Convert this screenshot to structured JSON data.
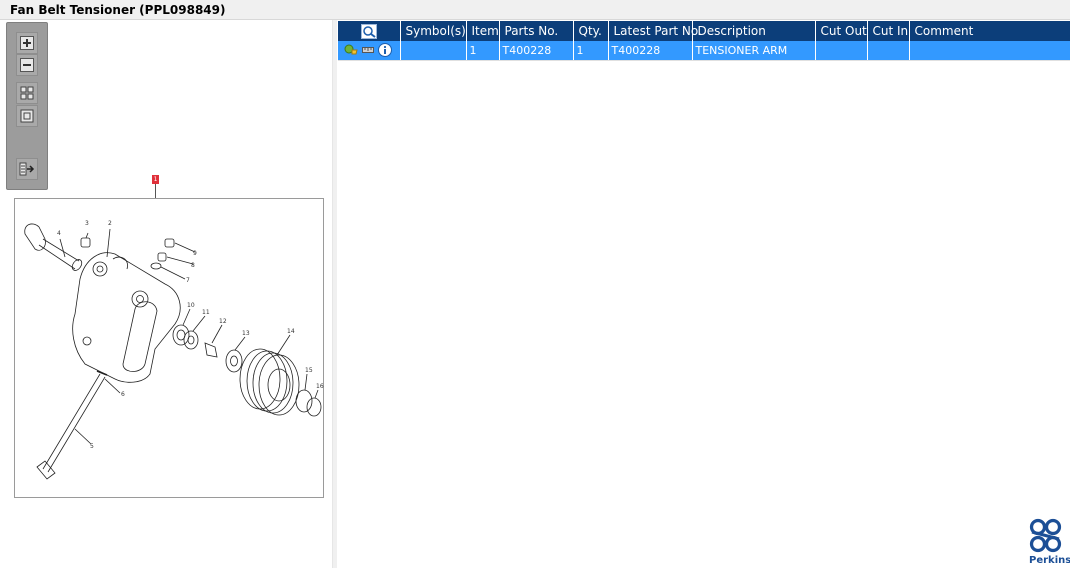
{
  "window": {
    "title": "Fan Belt Tensioner (PPL098849)"
  },
  "toolbar": {
    "buttons": [
      {
        "name": "zoom-in",
        "icon": "plus-icon"
      },
      {
        "name": "zoom-out",
        "icon": "minus-icon"
      },
      {
        "name": "fit-all",
        "icon": "grid-icon"
      },
      {
        "name": "actual-size",
        "icon": "square-icon"
      },
      {
        "name": "export",
        "icon": "list-arrow-icon"
      }
    ]
  },
  "drawing": {
    "callout_label": "1",
    "part_labels": [
      "2",
      "3",
      "4",
      "5",
      "6",
      "7",
      "8",
      "9",
      "10",
      "11",
      "12",
      "13",
      "14",
      "15",
      "16"
    ]
  },
  "table": {
    "header_icon": "search-parts-icon",
    "columns": [
      "Symbol(s)",
      "Item",
      "Parts No.",
      "Qty.",
      "Latest Part No.",
      "Description",
      "Cut Out",
      "Cut In",
      "Comment"
    ],
    "rows": [
      {
        "icons": [
          "add-to-cart-icon",
          "ruler-icon",
          "info-icon"
        ],
        "symbols": "",
        "item": "1",
        "parts_no": "T400228",
        "qty": "1",
        "latest_part_no": "T400228",
        "description": "TENSIONER ARM",
        "cut_out": "",
        "cut_in": "",
        "comment": ""
      }
    ],
    "selected_row_color": "#3399ff",
    "header_color": "#0c3e7a"
  },
  "brand": {
    "name": "Perkins",
    "color": "#1c4f96"
  }
}
